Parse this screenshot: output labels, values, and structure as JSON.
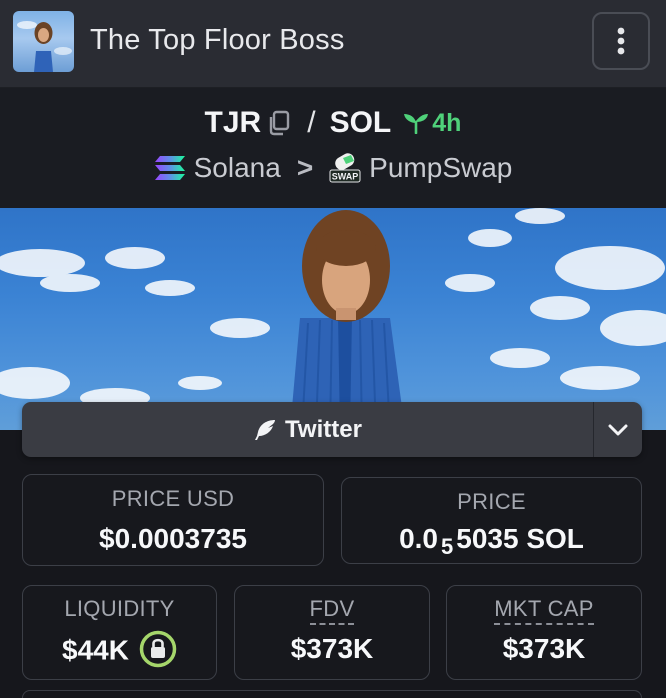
{
  "header": {
    "title": "The Top Floor Boss",
    "avatar_icon": "token-avatar-image",
    "more_icon": "vertical-dots-icon"
  },
  "pair": {
    "base": "TJR",
    "separator": "/",
    "quote": "SOL",
    "age": "4h"
  },
  "chain": {
    "network": "Solana",
    "separator": ">",
    "dex": "PumpSwap",
    "dex_badge": "SWAP"
  },
  "social": {
    "twitter_label": "Twitter"
  },
  "stats": {
    "price_usd": {
      "label": "PRICE USD",
      "value": "$0.0003735"
    },
    "price": {
      "label": "PRICE",
      "prefix": "0.0",
      "zeros": "5",
      "suffix": "5035 SOL"
    },
    "liquidity": {
      "label": "LIQUIDITY",
      "value": "$44K"
    },
    "fdv": {
      "label": "FDV",
      "value": "$373K"
    },
    "mkt_cap": {
      "label": "MKT CAP",
      "value": "$373K"
    }
  },
  "colors": {
    "accent_green": "#4fd17a",
    "lock_ring": "#a5d66b",
    "header_bg": "#2a2c33",
    "panel_bg": "#16171c"
  }
}
